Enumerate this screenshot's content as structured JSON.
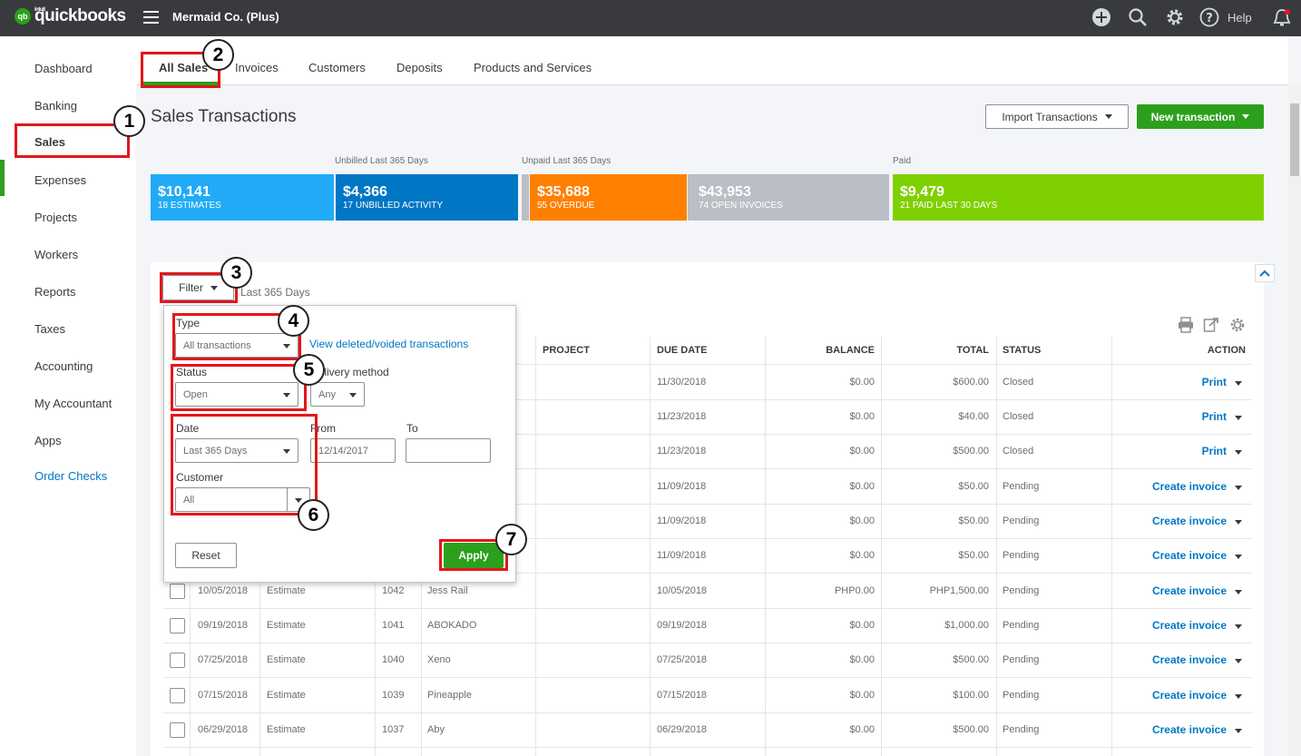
{
  "app": {
    "logo_intuit": "intuit",
    "logo_name": "quickbooks",
    "logo_badge": "qb",
    "company": "Mermaid Co. (Plus)",
    "help": "Help",
    "icons": [
      "plus-icon",
      "search-icon",
      "gear-icon",
      "help-icon",
      "bell-icon"
    ],
    "brand_color": "#2ca01c"
  },
  "sidebar": {
    "items": [
      {
        "label": "Dashboard"
      },
      {
        "label": "Banking"
      },
      {
        "label": "Sales"
      },
      {
        "label": "Expenses"
      },
      {
        "label": "Projects"
      },
      {
        "label": "Workers"
      },
      {
        "label": "Reports"
      },
      {
        "label": "Taxes"
      },
      {
        "label": "Accounting"
      },
      {
        "label": "My Accountant"
      },
      {
        "label": "Apps"
      },
      {
        "label": "Order Checks"
      }
    ],
    "active": "Sales"
  },
  "tabs": [
    {
      "label": "All Sales"
    },
    {
      "label": "Invoices"
    },
    {
      "label": "Customers"
    },
    {
      "label": "Deposits"
    },
    {
      "label": "Products and Services"
    }
  ],
  "page": {
    "title": "Sales Transactions",
    "import_label": "Import Transactions",
    "new_label": "New transaction"
  },
  "stats": {
    "labels": {
      "unbilled": "Unbilled Last 365 Days",
      "unpaid": "Unpaid Last 365 Days",
      "paid": "Paid"
    },
    "boxes": [
      {
        "amount": "$10,141",
        "sub": "18 ESTIMATES",
        "color": "#21abf6"
      },
      {
        "amount": "$4,366",
        "sub": "17 UNBILLED ACTIVITY",
        "color": "#0077c5"
      },
      {
        "amount": "$35,688",
        "sub": "55 OVERDUE",
        "color": "#ff8000"
      },
      {
        "amount": "$43,953",
        "sub": "74 OPEN INVOICES",
        "color": "#babec5"
      },
      {
        "amount": "$9,479",
        "sub": "21 PAID LAST 30 DAYS",
        "color": "#7fd000"
      }
    ]
  },
  "filter": {
    "button": "Filter",
    "note": "Last 365 Days",
    "type_label": "Type",
    "type_value": "All transactions",
    "view_deleted": "View deleted/voided transactions",
    "status_label": "Status",
    "status_value": "Open",
    "delivery_label": "Delivery method",
    "delivery_value": "Any",
    "date_label": "Date",
    "date_value": "Last 365 Days",
    "from_label": "From",
    "from_value": "12/14/2017",
    "to_label": "To",
    "to_value": "",
    "customer_label": "Customer",
    "customer_value": "All",
    "reset": "Reset",
    "apply": "Apply"
  },
  "table": {
    "headers": {
      "project": "PROJECT",
      "due_date": "DUE DATE",
      "balance": "BALANCE",
      "total": "TOTAL",
      "status": "STATUS",
      "action": "ACTION"
    },
    "rows": [
      {
        "date": "",
        "type": "",
        "no": "",
        "customer": "",
        "due": "11/30/2018",
        "balance": "$0.00",
        "total": "$600.00",
        "status": "Closed",
        "action": "Print"
      },
      {
        "date": "",
        "type": "",
        "no": "",
        "customer": "",
        "due": "11/23/2018",
        "balance": "$0.00",
        "total": "$40.00",
        "status": "Closed",
        "action": "Print"
      },
      {
        "date": "",
        "type": "",
        "no": "",
        "customer": "",
        "due": "11/23/2018",
        "balance": "$0.00",
        "total": "$500.00",
        "status": "Closed",
        "action": "Print"
      },
      {
        "date": "",
        "type": "",
        "no": "",
        "customer": "",
        "due": "11/09/2018",
        "balance": "$0.00",
        "total": "$50.00",
        "status": "Pending",
        "action": "Create invoice"
      },
      {
        "date": "",
        "type": "",
        "no": "",
        "customer": "",
        "due": "11/09/2018",
        "balance": "$0.00",
        "total": "$50.00",
        "status": "Pending",
        "action": "Create invoice"
      },
      {
        "date": "",
        "type": "",
        "no": "",
        "customer": "",
        "due": "11/09/2018",
        "balance": "$0.00",
        "total": "$50.00",
        "status": "Pending",
        "action": "Create invoice"
      },
      {
        "date": "10/05/2018",
        "type": "Estimate",
        "no": "1042",
        "customer": "Jess Rail",
        "due": "10/05/2018",
        "balance": "PHP0.00",
        "total": "PHP1,500.00",
        "status": "Pending",
        "action": "Create invoice"
      },
      {
        "date": "09/19/2018",
        "type": "Estimate",
        "no": "1041",
        "customer": "ABOKADO",
        "due": "09/19/2018",
        "balance": "$0.00",
        "total": "$1,000.00",
        "status": "Pending",
        "action": "Create invoice"
      },
      {
        "date": "07/25/2018",
        "type": "Estimate",
        "no": "1040",
        "customer": "Xeno",
        "due": "07/25/2018",
        "balance": "$0.00",
        "total": "$500.00",
        "status": "Pending",
        "action": "Create invoice"
      },
      {
        "date": "07/15/2018",
        "type": "Estimate",
        "no": "1039",
        "customer": "Pineapple",
        "due": "07/15/2018",
        "balance": "$0.00",
        "total": "$100.00",
        "status": "Pending",
        "action": "Create invoice"
      },
      {
        "date": "06/29/2018",
        "type": "Estimate",
        "no": "1037",
        "customer": "Aby",
        "due": "06/29/2018",
        "balance": "$0.00",
        "total": "$500.00",
        "status": "Pending",
        "action": "Create invoice"
      }
    ]
  },
  "annotations": [
    "1",
    "2",
    "3",
    "4",
    "5",
    "6",
    "7"
  ],
  "annotation_color": "#e3161b"
}
